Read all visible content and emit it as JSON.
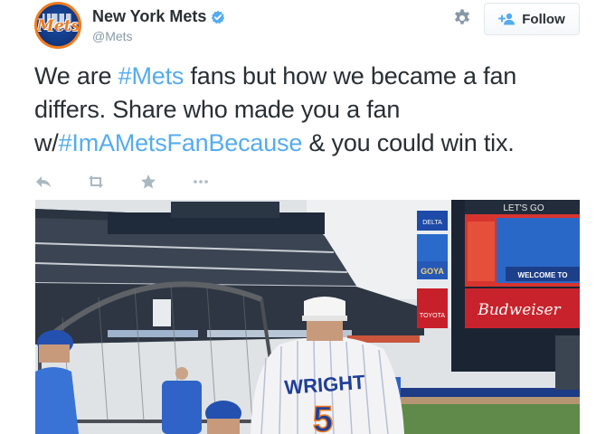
{
  "account": {
    "display_name": "New York Mets",
    "handle": "@Mets",
    "avatar_text": "Mets",
    "verified": true
  },
  "header": {
    "settings_icon": "gear-icon",
    "follow_label": "Follow",
    "follow_icon": "add-user-icon"
  },
  "tweet": {
    "parts": [
      {
        "text": "We are ",
        "type": "text"
      },
      {
        "text": "#Mets",
        "type": "hashtag"
      },
      {
        "text": " fans but how we became a fan differs. Share who made you a fan w/",
        "type": "text"
      },
      {
        "text": "#ImAMetsFanBecause",
        "type": "hashtag"
      },
      {
        "text": " & you could win tix.",
        "type": "text"
      }
    ]
  },
  "actions": [
    {
      "name": "reply",
      "icon": "reply-icon"
    },
    {
      "name": "retweet",
      "icon": "retweet-icon"
    },
    {
      "name": "favorite",
      "icon": "star-icon"
    },
    {
      "name": "more",
      "icon": "more-icon"
    }
  ],
  "photo": {
    "signs": {
      "goya": "GOYA",
      "toyota": "TOYOTA",
      "delta": "DELTA",
      "welcome": "WELCOME TO",
      "budweiser": "Budweiser",
      "letsgo": "LET'S GO"
    },
    "jersey_name": "WRIGHT",
    "jersey_number": "5"
  },
  "colors": {
    "link": "#55acee",
    "text": "#292f33",
    "muted": "#8899a6",
    "mets_orange": "#f07b1e",
    "mets_blue": "#123a85"
  }
}
